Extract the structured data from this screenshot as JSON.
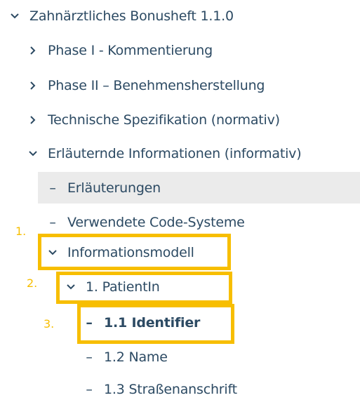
{
  "tree": {
    "root": {
      "label": "Zahnärztliches Bonusheft 1.1.0"
    },
    "phase1": {
      "label": "Phase I - Kommentierung"
    },
    "phase2": {
      "label": "Phase II – Benehmensherstellung"
    },
    "tech": {
      "label": "Technische Spezifikation (normativ)"
    },
    "info": {
      "label": "Erläuternde Informationen (informativ)"
    },
    "erlaeuterungen": {
      "label": "Erläuterungen"
    },
    "codesysteme": {
      "label": "Verwendete Code-Systeme"
    },
    "infomodell": {
      "label": "Informationsmodell"
    },
    "patient": {
      "label": "1. PatientIn"
    },
    "identifier": {
      "label": "1.1 Identifier"
    },
    "name": {
      "label": "1.2 Name"
    },
    "strasse": {
      "label": "1.3 Straßenanschrift"
    }
  },
  "annotations": {
    "one": "1.",
    "two": "2.",
    "three": "3."
  },
  "colors": {
    "text": "#2c4a63",
    "highlight": "#f7be00",
    "selected_bg": "#ebebeb"
  },
  "icons": {
    "expanded": "chevron-down-icon",
    "collapsed": "chevron-right-icon",
    "leaf": "dash"
  }
}
